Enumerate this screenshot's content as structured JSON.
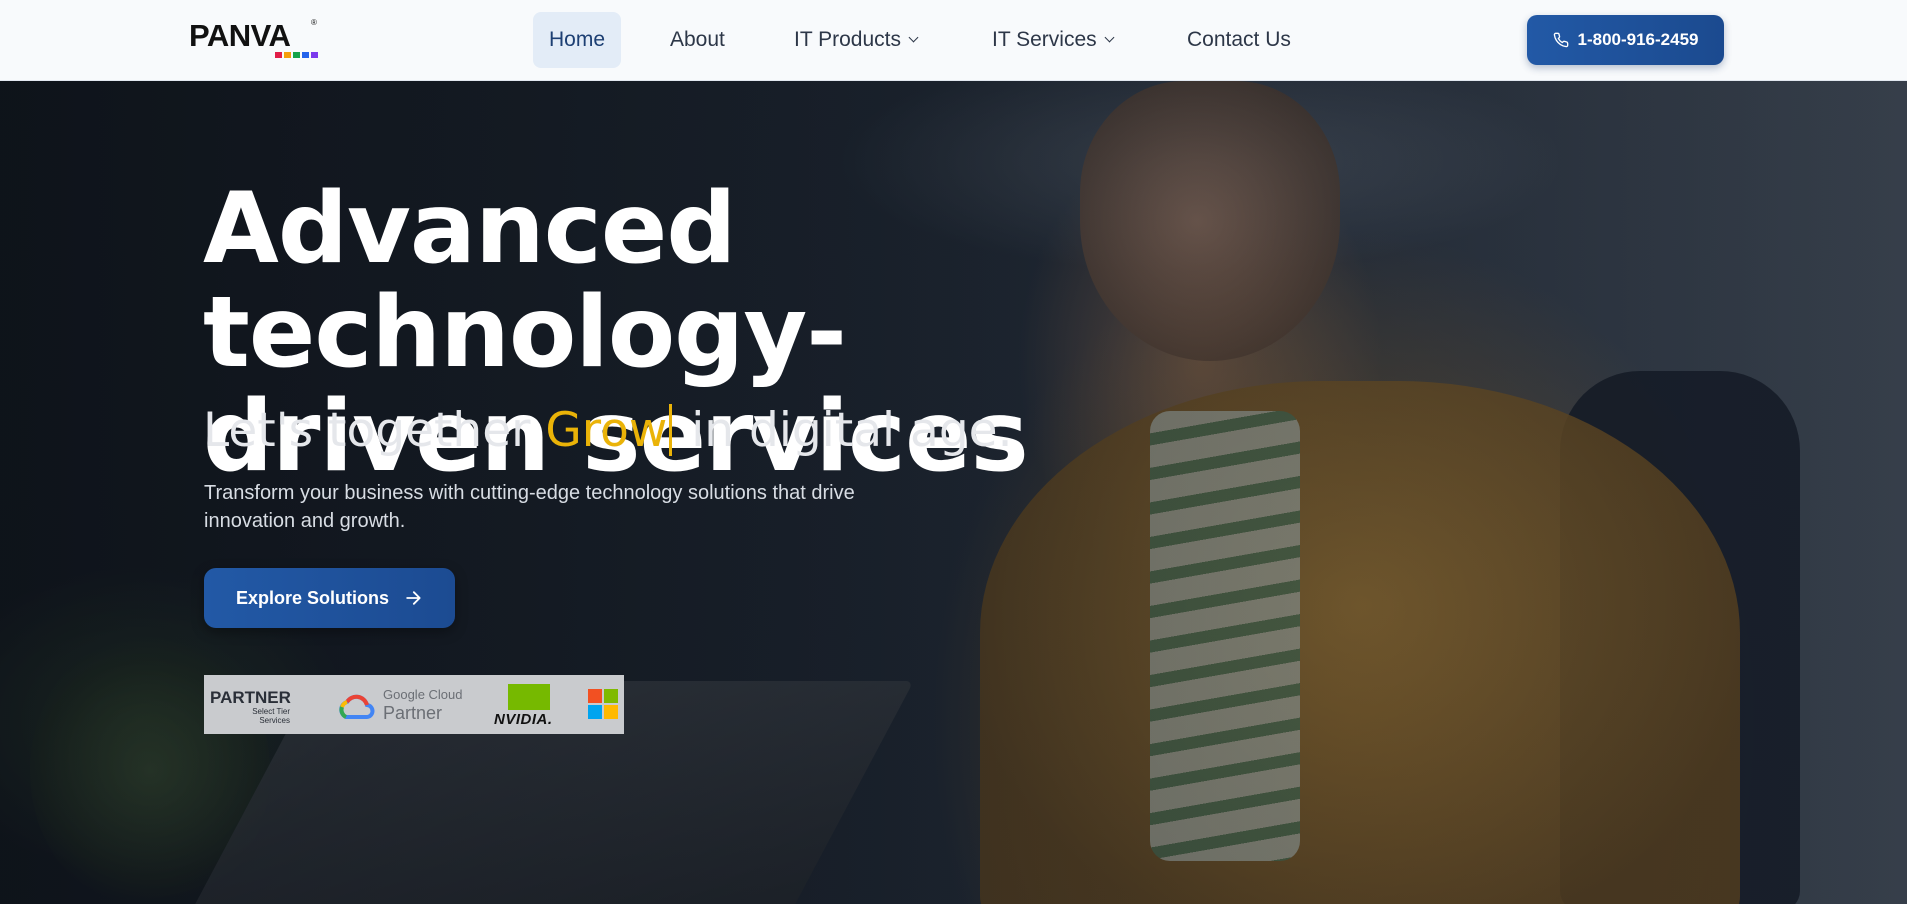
{
  "header": {
    "logo": {
      "text": "PANVA",
      "registered": "®",
      "dot_colors": [
        "#e11d48",
        "#f59e0b",
        "#16a34a",
        "#2563eb",
        "#7c3aed"
      ]
    },
    "nav": [
      {
        "label": "Home",
        "active": true
      },
      {
        "label": "About",
        "active": false
      },
      {
        "label": "IT Products",
        "active": false,
        "dropdown": true
      },
      {
        "label": "IT Services",
        "active": false,
        "dropdown": true
      },
      {
        "label": "Contact Us",
        "active": false
      }
    ],
    "phone": {
      "label": "1-800-916-2459",
      "icon": "phone-icon"
    }
  },
  "hero": {
    "title_line1": "Advanced technology-",
    "title_line2": "driven services",
    "subtitle_before": "Let's together ",
    "subtitle_highlight": "Grow",
    "subtitle_after": " in digital age.",
    "description": "Transform your business with cutting-edge technology solutions that drive innovation and growth.",
    "cta": {
      "label": "Explore Solutions",
      "icon": "arrow-right-icon"
    },
    "partners": {
      "partner_big": "PARTNER",
      "partner_small_1": "Select Tier",
      "partner_small_2": "Services",
      "gcloud_line1": "Google Cloud",
      "gcloud_line2": "Partner",
      "nvidia": "NVIDIA."
    }
  },
  "colors": {
    "accent": "#1f5199",
    "highlight": "#eab308",
    "nav_active_bg": "#e3ecf7"
  }
}
